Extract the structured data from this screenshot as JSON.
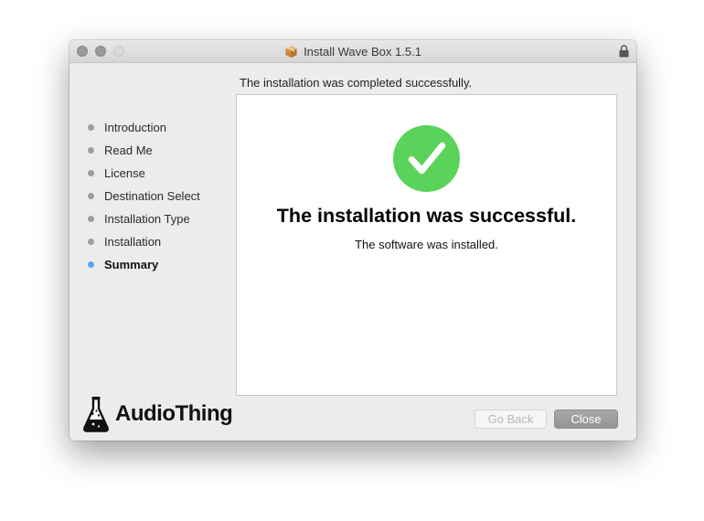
{
  "window": {
    "title": "Install Wave Box 1.5.1",
    "title_icon": "package-icon",
    "lock_icon": "lock-icon"
  },
  "header": {
    "message": "The installation was completed successfully."
  },
  "sidebar": {
    "items": [
      {
        "label": "Introduction",
        "active": false
      },
      {
        "label": "Read Me",
        "active": false
      },
      {
        "label": "License",
        "active": false
      },
      {
        "label": "Destination Select",
        "active": false
      },
      {
        "label": "Installation Type",
        "active": false
      },
      {
        "label": "Installation",
        "active": false
      },
      {
        "label": "Summary",
        "active": true
      }
    ],
    "active_color": "#5aa6f0",
    "inactive_color": "#9e9e9e"
  },
  "main": {
    "icon": "checkmark-circle-icon",
    "icon_color": "#5ad35b",
    "title": "The installation was successful.",
    "subtitle": "The software was installed."
  },
  "brand": {
    "logo_icon": "flask-icon",
    "name": "AudioThing"
  },
  "buttons": {
    "back_label": "Go Back",
    "back_enabled": false,
    "close_label": "Close"
  }
}
